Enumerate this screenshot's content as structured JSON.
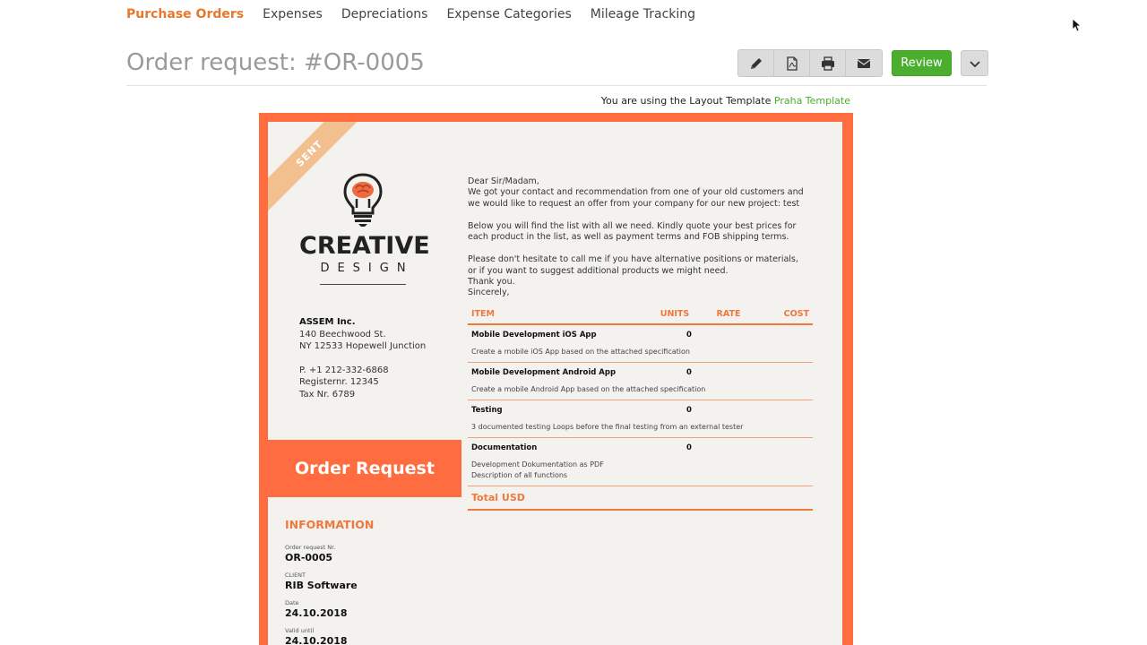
{
  "nav": {
    "items": [
      {
        "label": "Purchase Orders",
        "active": true
      },
      {
        "label": "Expenses",
        "active": false
      },
      {
        "label": "Depreciations",
        "active": false
      },
      {
        "label": "Expense Categories",
        "active": false
      },
      {
        "label": "Mileage Tracking",
        "active": false
      }
    ]
  },
  "header": {
    "title": "Order request: #OR-0005",
    "review_label": "Review",
    "tools": [
      "pencil-icon",
      "pdf-icon",
      "print-icon",
      "mail-icon"
    ]
  },
  "layout_note": {
    "prefix": "You are using the Layout Template",
    "template_name": "Praha Template"
  },
  "document": {
    "ribbon": "SENT",
    "logo": {
      "title": "CREATIVE",
      "subtitle": "DESIGN"
    },
    "company": {
      "name": "ASSEM Inc.",
      "street": "140 Beechwood St.",
      "city": "NY 12533  Hopewell Junction",
      "phone": "P. +1 212-332-6868",
      "register": "Registernr. 12345",
      "tax": "Tax Nr. 6789"
    },
    "band_title": "Order Request",
    "info": {
      "heading": "INFORMATION",
      "fields": [
        {
          "label": "Order request Nr.",
          "value": "OR-0005"
        },
        {
          "label": "CLIENT",
          "value": "RIB Software"
        },
        {
          "label": "Date",
          "value": "24.10.2018"
        },
        {
          "label": "Valid until",
          "value": "24.10.2018"
        }
      ]
    },
    "letter": {
      "p1_line1": "Dear Sir/Madam,",
      "p1_line2": "We got your contact and recommendation from one of your old customers and we would like to request an offer from your company for our new project: test",
      "p2": "Below you will find the list with all we need. Kindly quote your best prices for each product in the list, as well as payment terms and FOB shipping terms.",
      "p3_line1": "Please don't hesitate to call me if you have alternative positions or materials, or if you want to suggest additional products we might need.",
      "p3_line2": "Thank you.",
      "p3_line3": "Sincerely,"
    },
    "table": {
      "headers": {
        "item": "ITEM",
        "units": "UNITS",
        "rate": "RATE",
        "cost": "COST"
      },
      "rows": [
        {
          "name": "Mobile Development iOS App",
          "units": "0",
          "desc": "Create a mobile iOS App based on the attached specification"
        },
        {
          "name": "Mobile Development Android App",
          "units": "0",
          "desc": "Create a mobile Android App based on the attached specification"
        },
        {
          "name": "Testing",
          "units": "0",
          "desc": "3 documented testing Loops before the final testing from an external tester"
        },
        {
          "name": "Documentation",
          "units": "0",
          "desc": "Development Dokumentation as PDF",
          "desc2": "Description of all functions"
        }
      ],
      "total_label": "Total USD"
    }
  },
  "colors": {
    "accent": "#ff6c3f",
    "nav_active": "#e8782d",
    "review": "#4cae2e"
  }
}
